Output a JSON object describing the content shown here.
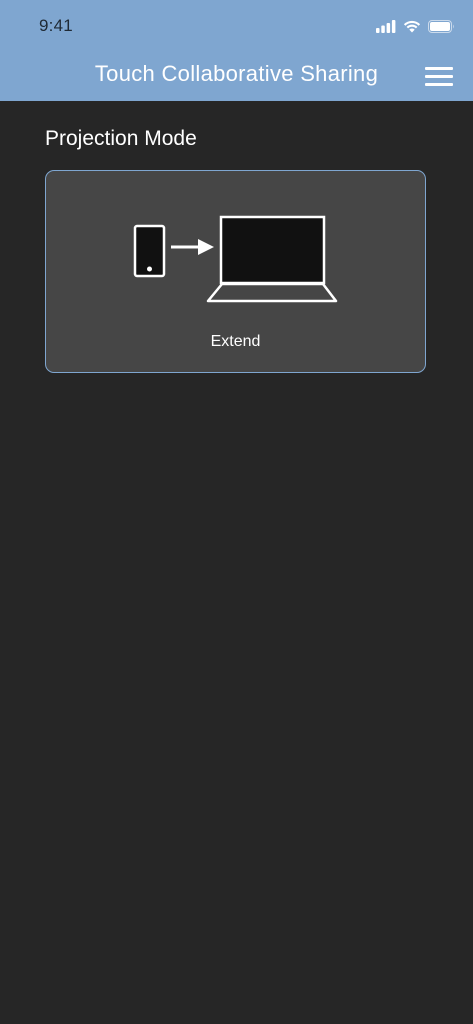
{
  "status_bar": {
    "time": "9:41",
    "icons": [
      "signal-icon",
      "wifi-icon",
      "battery-icon"
    ]
  },
  "header": {
    "title": "Touch Collaborative Sharing",
    "menu_icon": "hamburger-menu-icon",
    "background_color": "#7fa6d0"
  },
  "main": {
    "section_title": "Projection Mode",
    "modes": [
      {
        "label": "Extend",
        "icon": "phone-to-laptop-icon",
        "selected": true
      }
    ]
  },
  "colors": {
    "background": "#262626",
    "card": "#464646",
    "accent": "#7fa6d0"
  }
}
